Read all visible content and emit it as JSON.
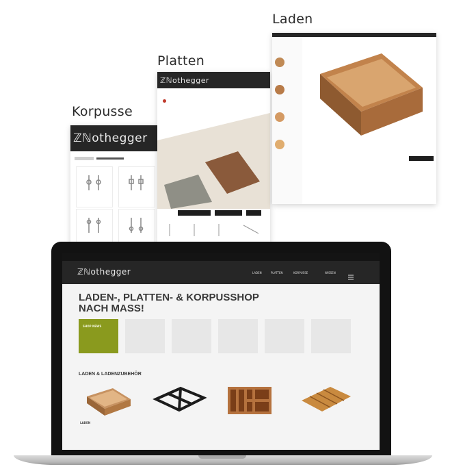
{
  "labels": {
    "korpusse": "Korpusse",
    "platten": "Platten",
    "laden": "Laden"
  },
  "brand": {
    "logo_text": "ℤℕothegger",
    "colors": {
      "accent": "#8a9a1e",
      "header": "#262626"
    }
  },
  "korpusse_card": {
    "items": [
      "",
      "",
      "",
      "",
      "",
      ""
    ]
  },
  "laptop": {
    "nav": [
      "LADEN",
      "PLATTEN",
      "KORPUSSE",
      "WISSEN"
    ],
    "hero_title": "LADEN-, PLATTEN- & KORPUSSHOP NACH MASS!",
    "tiles": [
      {
        "label": "SHOP NEWS",
        "active": true
      },
      {
        "label": "",
        "active": false
      },
      {
        "label": "",
        "active": false
      },
      {
        "label": "",
        "active": false
      },
      {
        "label": "",
        "active": false
      },
      {
        "label": "",
        "active": false
      }
    ],
    "section_title": "LADEN & LADENZUBEHÖR",
    "products": [
      {
        "name": "LADEN",
        "icon": "wooden-drawer-icon"
      },
      {
        "name": "",
        "icon": "drawer-frame-icon"
      },
      {
        "name": "",
        "icon": "drawer-organizer-icon"
      },
      {
        "name": "",
        "icon": "cutlery-tray-icon"
      }
    ]
  }
}
